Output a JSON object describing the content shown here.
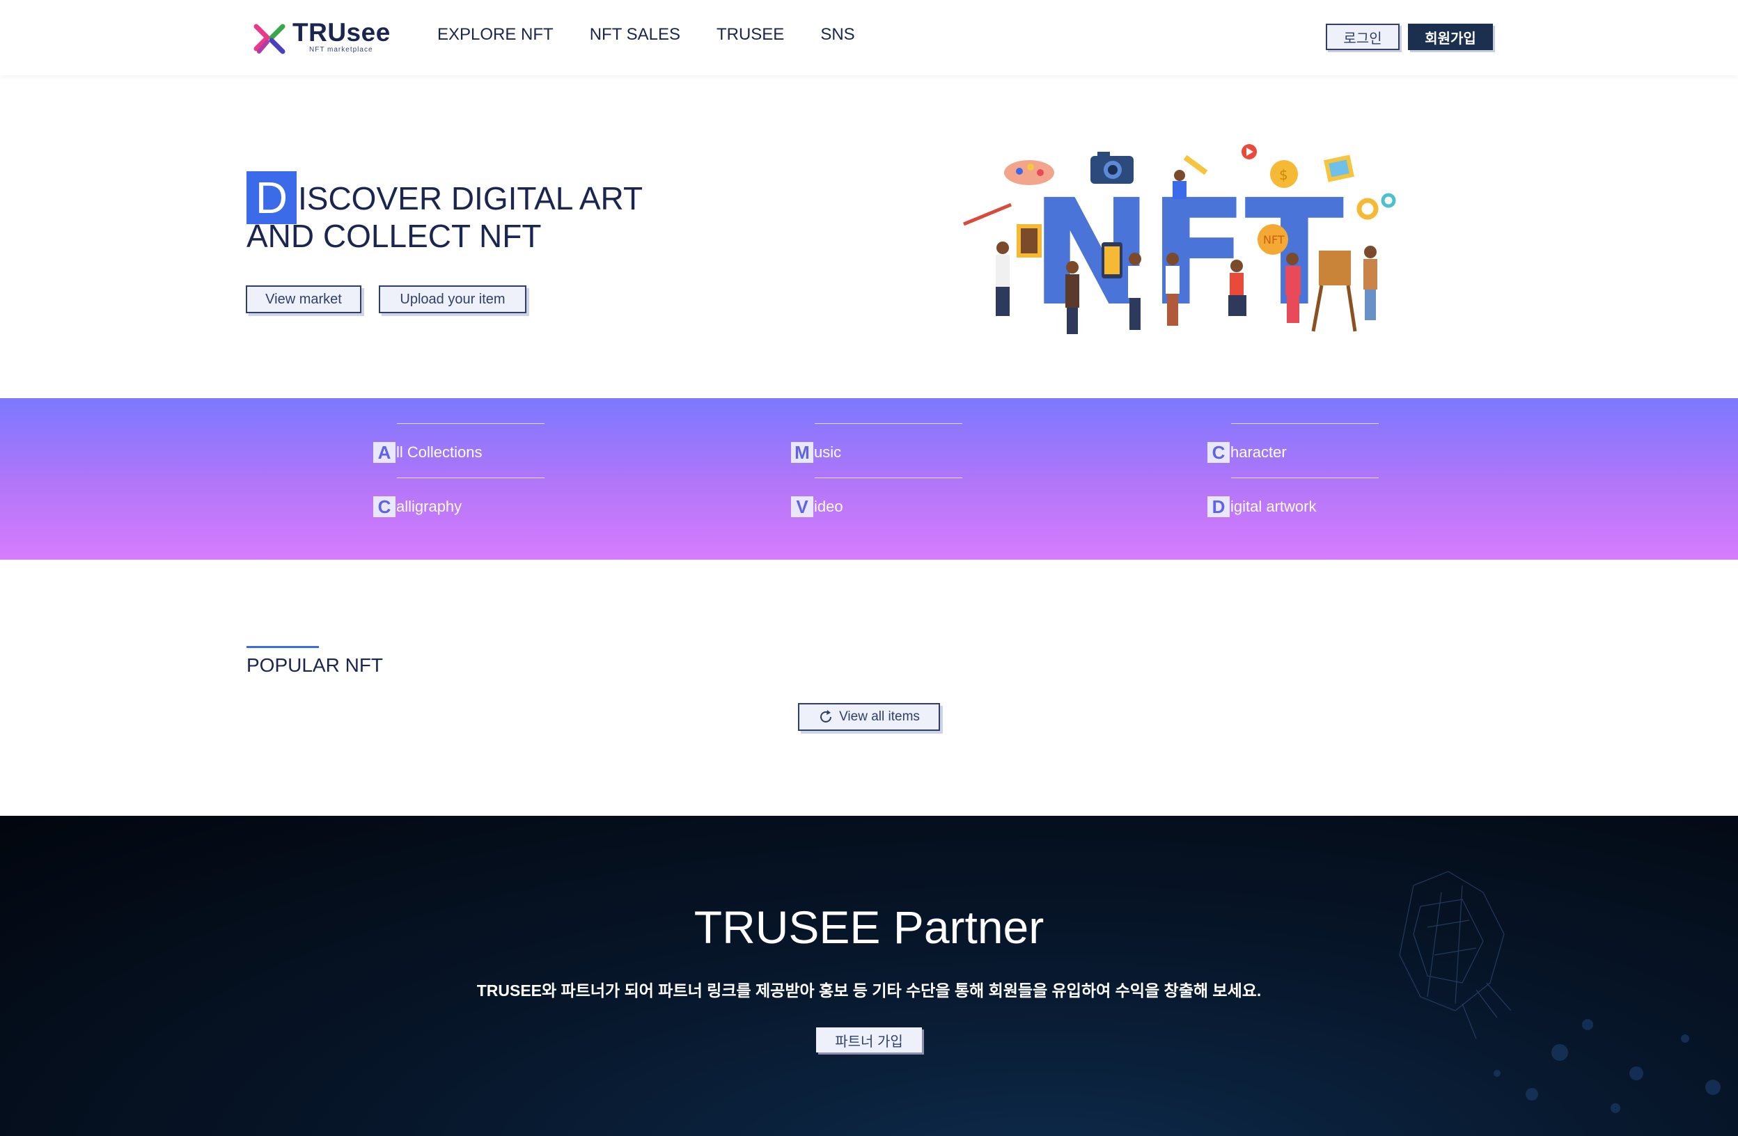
{
  "header": {
    "logo_text": "TRUsee",
    "logo_sub": "NFT marketplace",
    "nav": [
      "EXPLORE NFT",
      "NFT SALES",
      "TRUSEE",
      "SNS"
    ],
    "login_label": "로그인",
    "join_label": "회원가입"
  },
  "hero": {
    "title_cap": "D",
    "title_line1_rest": "ISCOVER DIGITAL ART",
    "title_line2": "AND COLLECT NFT",
    "view_market_label": "View market",
    "upload_label": "Upload your item",
    "illustration_text": "NFT"
  },
  "categories": [
    {
      "cap": "A",
      "rest": "ll Collections"
    },
    {
      "cap": "M",
      "rest": "usic"
    },
    {
      "cap": "C",
      "rest": "haracter"
    },
    {
      "cap": "C",
      "rest": "alligraphy"
    },
    {
      "cap": "V",
      "rest": "ideo"
    },
    {
      "cap": "D",
      "rest": "igital artwork"
    }
  ],
  "popular": {
    "title": "POPULAR NFT",
    "view_all_label": "View all items"
  },
  "partner": {
    "title": "TRUSEE Partner",
    "description": "TRUSEE와 파트너가 되어 파트너 링크를 제공받아 홍보 등 기타 수단을 통해 회원들을 유입하여 수익을 창출해 보세요.",
    "button_label": "파트너 가입"
  },
  "colors": {
    "accent_blue": "#3b6be8",
    "navy": "#1b2f4f",
    "band_top": "#7b78ff",
    "band_bottom": "#d77cff"
  }
}
